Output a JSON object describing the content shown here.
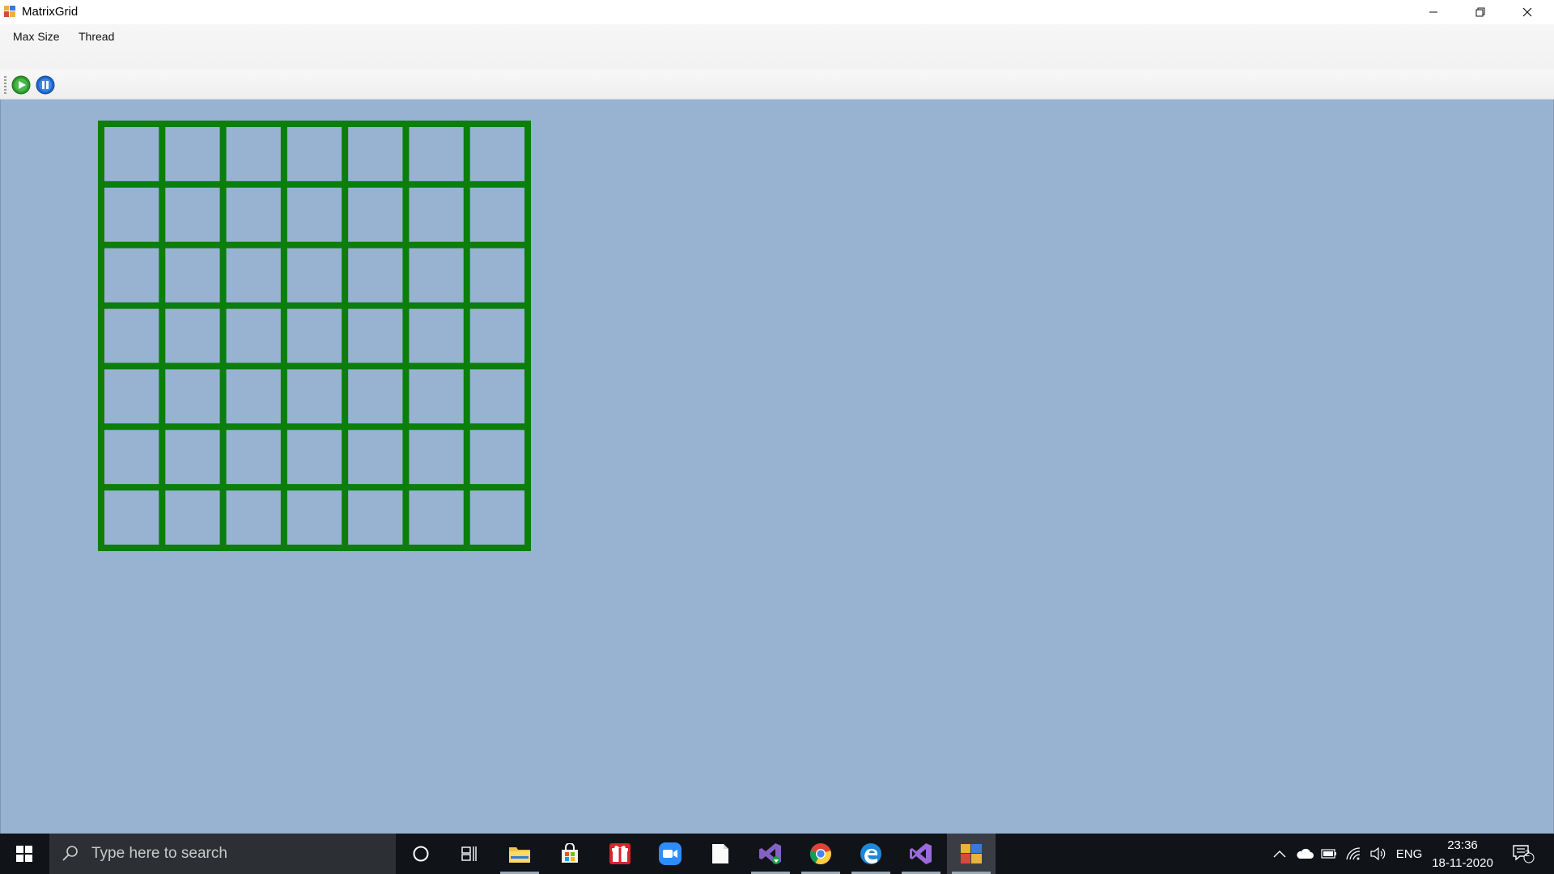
{
  "window": {
    "title": "MatrixGrid",
    "controls": {
      "minimize": "minimize-icon",
      "restore": "restore-icon",
      "close": "close-icon"
    }
  },
  "menu": {
    "items": [
      {
        "label": "Max Size"
      },
      {
        "label": "Thread"
      }
    ]
  },
  "toolbar": {
    "buttons": [
      {
        "icon": "play-icon",
        "color": "#2e9a2e"
      },
      {
        "icon": "pause-icon",
        "color": "#1f66c9"
      }
    ]
  },
  "canvas": {
    "background": "#98b2d1",
    "grid": {
      "rows": 7,
      "cols": 7,
      "line_color": "#0b7e0b"
    }
  },
  "taskbar": {
    "search_placeholder": "Type here to search",
    "apps": [
      "cortana-icon",
      "task-view-icon",
      "file-explorer-icon",
      "store-icon",
      "gift-icon",
      "zoom-icon",
      "notepad-icon",
      "visual-studio-installer-icon",
      "chrome-icon",
      "edge-icon",
      "visual-studio-icon",
      "matrixgrid-app-icon"
    ],
    "tray": {
      "language": "ENG",
      "time": "23:36",
      "date": "18-11-2020",
      "notifications": "2"
    }
  }
}
